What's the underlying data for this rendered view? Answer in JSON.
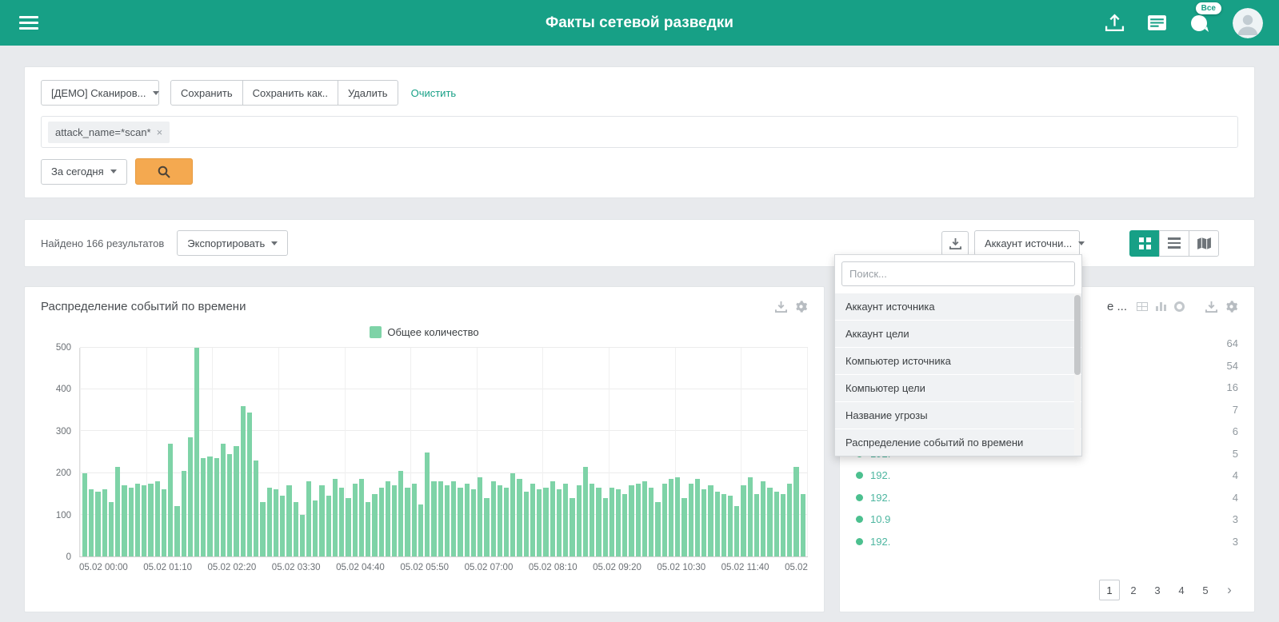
{
  "theme": {
    "accent": "#17a086",
    "search_button": "#f4a950",
    "bar_green": "#7ed3a7",
    "dot_green": "#4cc08f"
  },
  "header": {
    "title": "Факты сетевой разведки",
    "notifications_badge": "Все"
  },
  "filters": {
    "preset": "[ДЕМО] Сканиров...",
    "save": "Сохранить",
    "save_as": "Сохранить как..",
    "delete": "Удалить",
    "clear": "Очистить",
    "query_tag": "attack_name=*scan*",
    "period": "За сегодня"
  },
  "results": {
    "found": "Найдено 166 результатов",
    "count": 166,
    "export": "Экспортировать",
    "grouping": "Аккаунт источни..."
  },
  "grouping_dropdown": {
    "search_placeholder": "Поиск...",
    "items": [
      "Аккаунт источника",
      "Аккаунт цели",
      "Компьютер источника",
      "Компьютер цели",
      "Название угрозы",
      "Распределение событий по времени"
    ]
  },
  "chart_panel": {
    "title": "Распределение событий по времени",
    "legend": "Общее количество"
  },
  "chart_data": {
    "type": "bar",
    "title": "Распределение событий по времени",
    "series_name": "Общее количество",
    "bar_color": "#7ed3a7",
    "ylim": [
      0,
      500
    ],
    "y_ticks": [
      0,
      100,
      200,
      300,
      400,
      500
    ],
    "grid": true,
    "legend_position": "top",
    "x_tick_labels": [
      "05.02 00:00",
      "05.02 01:10",
      "05.02 02:20",
      "05.02 03:30",
      "05.02 04:40",
      "05.02 05:50",
      "05.02 07:00",
      "05.02 08:10",
      "05.02 09:20",
      "05.02 10:30",
      "05.02 11:40",
      "05.02"
    ],
    "values": [
      200,
      160,
      155,
      160,
      130,
      215,
      170,
      165,
      175,
      170,
      175,
      180,
      160,
      270,
      120,
      205,
      285,
      500,
      235,
      240,
      235,
      270,
      245,
      265,
      360,
      345,
      230,
      130,
      165,
      160,
      145,
      170,
      130,
      100,
      180,
      135,
      170,
      145,
      185,
      165,
      140,
      175,
      185,
      130,
      150,
      165,
      180,
      170,
      205,
      165,
      175,
      125,
      250,
      180,
      180,
      170,
      180,
      165,
      175,
      160,
      190,
      140,
      180,
      170,
      165,
      200,
      185,
      155,
      175,
      160,
      165,
      180,
      160,
      175,
      140,
      170,
      215,
      175,
      165,
      140,
      165,
      160,
      150,
      170,
      175,
      180,
      165,
      130,
      175,
      185,
      190,
      140,
      175,
      185,
      160,
      170,
      155,
      150,
      145,
      120,
      170,
      190,
      150,
      180,
      165,
      155,
      150,
      175,
      215,
      150
    ]
  },
  "group_panel": {
    "title_fragment": "е ...",
    "rows": [
      {
        "label": "",
        "value": "64"
      },
      {
        "label": "",
        "value": "54"
      },
      {
        "label": "",
        "value": "16"
      },
      {
        "label": "",
        "value": "7"
      },
      {
        "label": "",
        "value": "6"
      },
      {
        "label": "192.",
        "value": "5"
      },
      {
        "label": "192.",
        "value": "4"
      },
      {
        "label": "192.",
        "value": "4"
      },
      {
        "label": "10.9",
        "value": "3"
      },
      {
        "label": "192.",
        "value": "3"
      }
    ],
    "pagination": {
      "pages": [
        "1",
        "2",
        "3",
        "4",
        "5"
      ],
      "active": "1",
      "next": "›"
    }
  }
}
